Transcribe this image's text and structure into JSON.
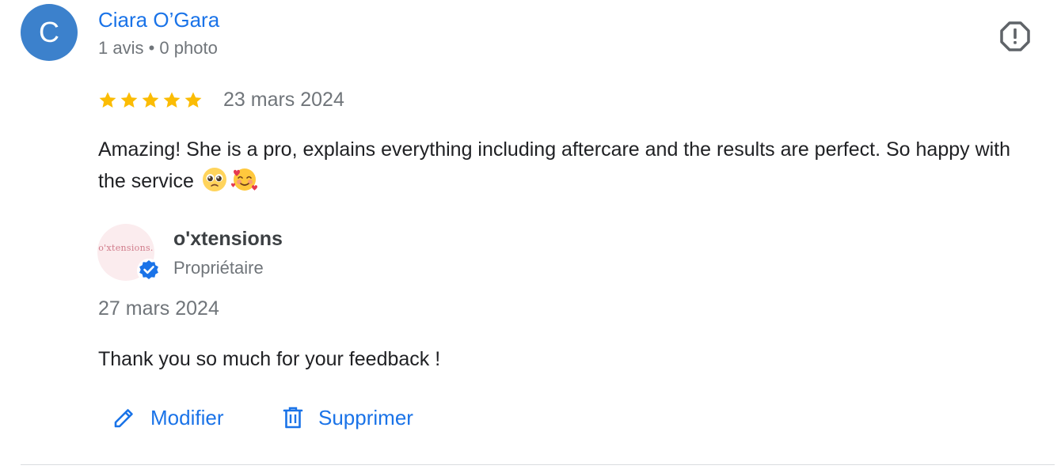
{
  "review": {
    "avatar_initial": "C",
    "avatar_color": "#3c81cc",
    "reviewer_name": "Ciara O’Gara",
    "reviewer_meta": "1 avis • 0 photo",
    "rating": 5,
    "max_rating": 5,
    "date": "23 mars 2024",
    "text": "Amazing! She is a pro, explains everything including aftercare and the results are perfect. So happy with the service",
    "emojis": [
      "pleading-face-emoji",
      "smiling-face-with-hearts-emoji"
    ],
    "report_icon": "report-icon"
  },
  "owner_reply": {
    "logo_text": "o'xtensions.",
    "name": "o'xtensions",
    "role": "Propriétaire",
    "verified_icon": "verified-badge-icon",
    "date": "27 mars 2024",
    "text": "Thank you so much for your feedback !"
  },
  "actions": {
    "edit_label": "Modifier",
    "edit_icon": "pencil-icon",
    "delete_label": "Supprimer",
    "delete_icon": "trash-icon"
  },
  "colors": {
    "link": "#1a73e8",
    "star": "#fbbc04",
    "secondary_text": "#70757a",
    "primary_text": "#202124"
  }
}
